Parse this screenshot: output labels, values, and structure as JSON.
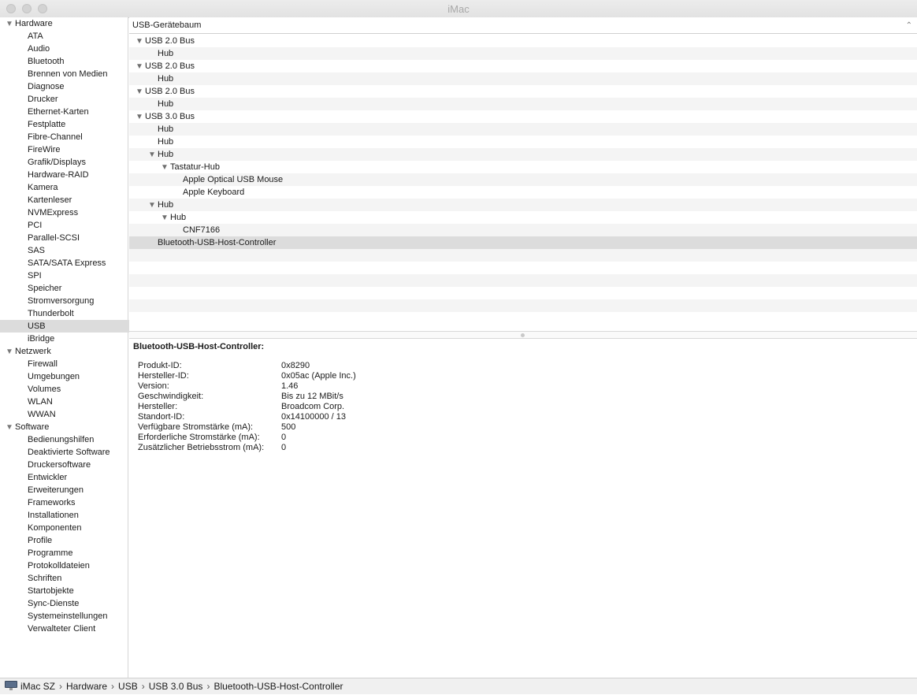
{
  "window": {
    "title": "iMac"
  },
  "sidebar": {
    "rows": [
      {
        "label": "Hardware",
        "group": true
      },
      {
        "label": "ATA"
      },
      {
        "label": "Audio"
      },
      {
        "label": "Bluetooth"
      },
      {
        "label": "Brennen von Medien"
      },
      {
        "label": "Diagnose"
      },
      {
        "label": "Drucker"
      },
      {
        "label": "Ethernet-Karten"
      },
      {
        "label": "Festplatte"
      },
      {
        "label": "Fibre-Channel"
      },
      {
        "label": "FireWire"
      },
      {
        "label": "Grafik/Displays"
      },
      {
        "label": "Hardware-RAID"
      },
      {
        "label": "Kamera"
      },
      {
        "label": "Kartenleser"
      },
      {
        "label": "NVMExpress"
      },
      {
        "label": "PCI"
      },
      {
        "label": "Parallel-SCSI"
      },
      {
        "label": "SAS"
      },
      {
        "label": "SATA/SATA Express"
      },
      {
        "label": "SPI"
      },
      {
        "label": "Speicher"
      },
      {
        "label": "Stromversorgung"
      },
      {
        "label": "Thunderbolt"
      },
      {
        "label": "USB",
        "selected": true
      },
      {
        "label": "iBridge"
      },
      {
        "label": "Netzwerk",
        "group": true
      },
      {
        "label": "Firewall"
      },
      {
        "label": "Umgebungen"
      },
      {
        "label": "Volumes"
      },
      {
        "label": "WLAN"
      },
      {
        "label": "WWAN"
      },
      {
        "label": "Software",
        "group": true
      },
      {
        "label": "Bedienungshilfen"
      },
      {
        "label": "Deaktivierte Software"
      },
      {
        "label": "Druckersoftware"
      },
      {
        "label": "Entwickler"
      },
      {
        "label": "Erweiterungen"
      },
      {
        "label": "Frameworks"
      },
      {
        "label": "Installationen"
      },
      {
        "label": "Komponenten"
      },
      {
        "label": "Profile"
      },
      {
        "label": "Programme"
      },
      {
        "label": "Protokolldateien"
      },
      {
        "label": "Schriften"
      },
      {
        "label": "Startobjekte"
      },
      {
        "label": "Sync-Dienste"
      },
      {
        "label": "Systemeinstellungen"
      },
      {
        "label": "Verwalteter Client"
      }
    ]
  },
  "tree": {
    "column_header": "USB-Gerätebaum",
    "rows": [
      {
        "label": "USB 2.0 Bus",
        "level": 0,
        "expanded": true
      },
      {
        "label": "Hub",
        "level": 1
      },
      {
        "label": "USB 2.0 Bus",
        "level": 0,
        "expanded": true
      },
      {
        "label": "Hub",
        "level": 1
      },
      {
        "label": "USB 2.0 Bus",
        "level": 0,
        "expanded": true
      },
      {
        "label": "Hub",
        "level": 1
      },
      {
        "label": "USB 3.0 Bus",
        "level": 0,
        "expanded": true
      },
      {
        "label": "Hub",
        "level": 1
      },
      {
        "label": "Hub",
        "level": 1
      },
      {
        "label": "Hub",
        "level": 1,
        "expanded": true
      },
      {
        "label": "Tastatur-Hub",
        "level": 2,
        "expanded": true
      },
      {
        "label": "Apple Optical USB Mouse",
        "level": 3
      },
      {
        "label": "Apple Keyboard",
        "level": 3
      },
      {
        "label": "Hub",
        "level": 1,
        "expanded": true
      },
      {
        "label": "Hub",
        "level": 2,
        "expanded": true
      },
      {
        "label": "CNF7166",
        "level": 3
      },
      {
        "label": "Bluetooth-USB-Host-Controller",
        "level": 1,
        "selected": true
      }
    ]
  },
  "details": {
    "title": "Bluetooth-USB-Host-Controller:",
    "properties": [
      {
        "key": "Produkt-ID:",
        "value": "0x8290"
      },
      {
        "key": "Hersteller-ID:",
        "value": "0x05ac  (Apple Inc.)"
      },
      {
        "key": "Version:",
        "value": "1.46"
      },
      {
        "key": "Geschwindigkeit:",
        "value": "Bis zu 12 MBit/s"
      },
      {
        "key": "Hersteller:",
        "value": "Broadcom Corp."
      },
      {
        "key": "Standort-ID:",
        "value": "0x14100000 / 13"
      },
      {
        "key": "Verfügbare Stromstärke (mA):",
        "value": "500"
      },
      {
        "key": "Erforderliche Stromstärke (mA):",
        "value": "0"
      },
      {
        "key": "Zusätzlicher Betriebsstrom (mA):",
        "value": "0"
      }
    ]
  },
  "statusbar": {
    "breadcrumb": [
      "iMac SZ",
      "Hardware",
      "USB",
      "USB 3.0 Bus",
      "Bluetooth-USB-Host-Controller"
    ],
    "separator": "›",
    "icon": "imac-icon"
  }
}
